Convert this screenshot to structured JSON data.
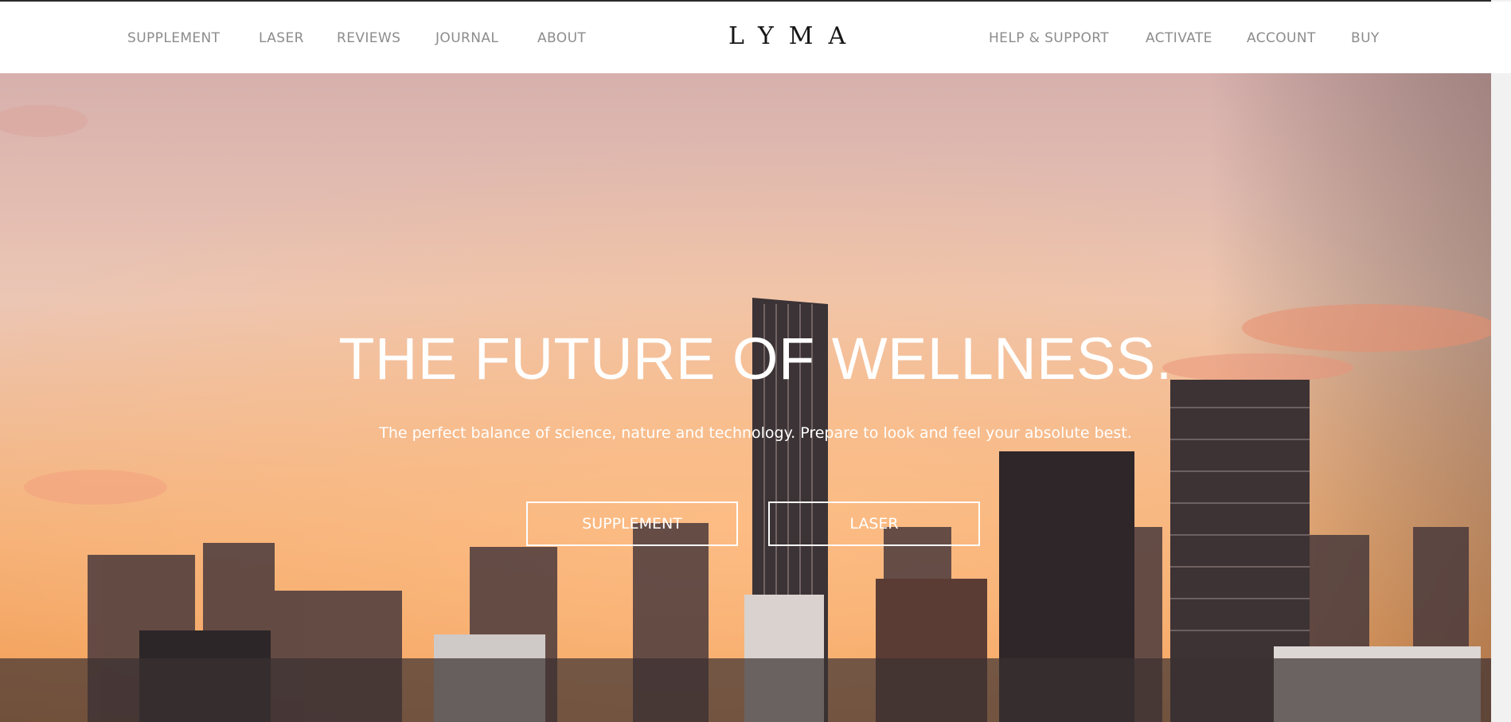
{
  "nav": {
    "left": [
      "SUPPLEMENT",
      "LASER",
      "REVIEWS",
      "JOURNAL",
      "ABOUT"
    ],
    "logo": "LYMA",
    "right": [
      "HELP & SUPPORT",
      "ACTIVATE",
      "ACCOUNT",
      "BUY"
    ]
  },
  "hero": {
    "title": "THE FUTURE OF WELLNESS.",
    "subtitle": "The perfect balance of science, nature and technology. Prepare to look and feel your absolute best.",
    "buttons": [
      "SUPPLEMENT",
      "LASER"
    ]
  },
  "colors": {
    "nav_text": "#8c8c8c",
    "logo": "#161616",
    "hero_text": "#ffffff",
    "sky_top": "#d9b1ad",
    "sky_bottom": "#f2a05c"
  }
}
